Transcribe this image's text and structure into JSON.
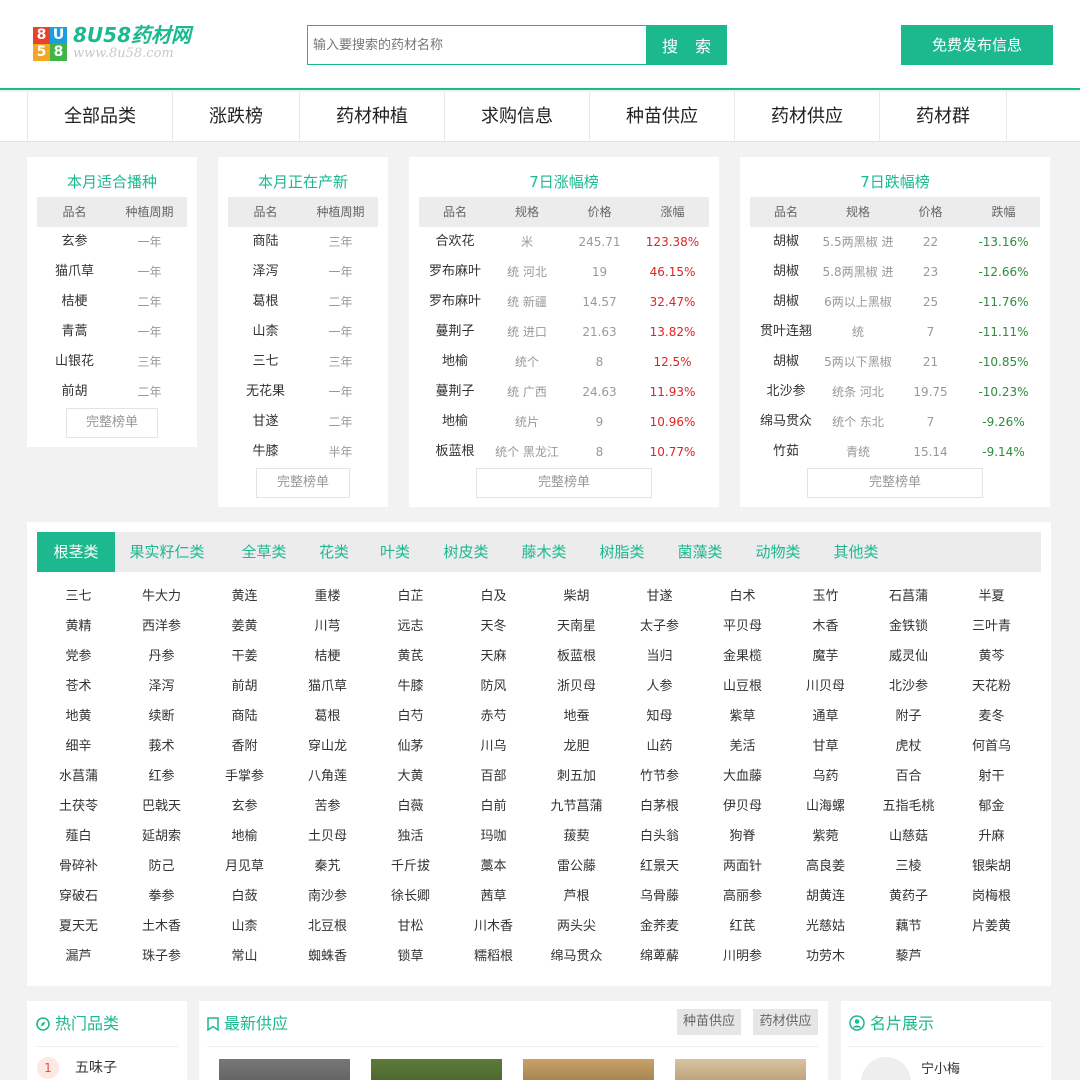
{
  "header": {
    "logo_badge": [
      "8",
      "U",
      "5",
      "8"
    ],
    "logo_text": "8U58药材网",
    "logo_url": "www.8u58.com",
    "search_placeholder": "输入要搜索的药材名称",
    "search_button": "搜 索",
    "publish_button": "免费发布信息"
  },
  "colors": {
    "brand": "#1cb98f",
    "up": "#e02424",
    "down": "#2c8d3a"
  },
  "nav": [
    "全部品类",
    "涨跌榜",
    "药材种植",
    "求购信息",
    "种苗供应",
    "药材供应",
    "药材群"
  ],
  "sow": {
    "title": "本月适合播种",
    "headers": [
      "品名",
      "种植周期"
    ],
    "rows": [
      [
        "玄参",
        "一年"
      ],
      [
        "猫爪草",
        "一年"
      ],
      [
        "桔梗",
        "二年"
      ],
      [
        "青蒿",
        "一年"
      ],
      [
        "山银花",
        "三年"
      ],
      [
        "前胡",
        "二年"
      ]
    ],
    "more": "完整榜单"
  },
  "harvest": {
    "title": "本月正在产新",
    "headers": [
      "品名",
      "种植周期"
    ],
    "rows": [
      [
        "商陆",
        "三年"
      ],
      [
        "泽泻",
        "一年"
      ],
      [
        "葛根",
        "二年"
      ],
      [
        "山柰",
        "一年"
      ],
      [
        "三七",
        "三年"
      ],
      [
        "无花果",
        "一年"
      ],
      [
        "甘遂",
        "二年"
      ],
      [
        "牛膝",
        "半年"
      ]
    ],
    "more": "完整榜单"
  },
  "rise": {
    "title": "7日涨幅榜",
    "headers": [
      "品名",
      "规格",
      "价格",
      "涨幅"
    ],
    "rows": [
      [
        "合欢花",
        "米",
        "245.71",
        "123.38%"
      ],
      [
        "罗布麻叶",
        "统 河北",
        "19",
        "46.15%"
      ],
      [
        "罗布麻叶",
        "统 新疆",
        "14.57",
        "32.47%"
      ],
      [
        "蔓荆子",
        "统 进口",
        "21.63",
        "13.82%"
      ],
      [
        "地榆",
        "统个",
        "8",
        "12.5%"
      ],
      [
        "蔓荆子",
        "统 广西",
        "24.63",
        "11.93%"
      ],
      [
        "地榆",
        "统片",
        "9",
        "10.96%"
      ],
      [
        "板蓝根",
        "统个 黑龙江",
        "8",
        "10.77%"
      ]
    ],
    "more": "完整榜单"
  },
  "fall": {
    "title": "7日跌幅榜",
    "headers": [
      "品名",
      "规格",
      "价格",
      "跌幅"
    ],
    "rows": [
      [
        "胡椒",
        "5.5两黑椒 进",
        "22",
        "-13.16%"
      ],
      [
        "胡椒",
        "5.8两黑椒 进",
        "23",
        "-12.66%"
      ],
      [
        "胡椒",
        "6两以上黑椒",
        "25",
        "-11.76%"
      ],
      [
        "贯叶连翘",
        "统",
        "7",
        "-11.11%"
      ],
      [
        "胡椒",
        "5两以下黑椒",
        "21",
        "-10.85%"
      ],
      [
        "北沙参",
        "统条 河北",
        "19.75",
        "-10.23%"
      ],
      [
        "绵马贯众",
        "统个 东北",
        "7",
        "-9.26%"
      ],
      [
        "竹茹",
        "青统",
        "15.14",
        "-9.14%"
      ]
    ],
    "more": "完整榜单"
  },
  "categories": {
    "tabs": [
      "根茎类",
      "果实籽仁类",
      "全草类",
      "花类",
      "叶类",
      "树皮类",
      "藤木类",
      "树脂类",
      "菌藻类",
      "动物类",
      "其他类"
    ],
    "active_tab": 0,
    "herbs": [
      "三七",
      "牛大力",
      "黄连",
      "重楼",
      "白芷",
      "白及",
      "柴胡",
      "甘遂",
      "白术",
      "玉竹",
      "石菖蒲",
      "半夏",
      "黄精",
      "西洋参",
      "姜黄",
      "川芎",
      "远志",
      "天冬",
      "天南星",
      "太子参",
      "平贝母",
      "木香",
      "金铁锁",
      "三叶青",
      "党参",
      "丹参",
      "干姜",
      "桔梗",
      "黄芪",
      "天麻",
      "板蓝根",
      "当归",
      "金果榄",
      "魔芋",
      "威灵仙",
      "黄芩",
      "苍术",
      "泽泻",
      "前胡",
      "猫爪草",
      "牛膝",
      "防风",
      "浙贝母",
      "人参",
      "山豆根",
      "川贝母",
      "北沙参",
      "天花粉",
      "地黄",
      "续断",
      "商陆",
      "葛根",
      "白芍",
      "赤芍",
      "地蚕",
      "知母",
      "紫草",
      "通草",
      "附子",
      "麦冬",
      "细辛",
      "莪术",
      "香附",
      "穿山龙",
      "仙茅",
      "川乌",
      "龙胆",
      "山药",
      "羌活",
      "甘草",
      "虎杖",
      "何首乌",
      "水菖蒲",
      "红参",
      "手掌参",
      "八角莲",
      "大黄",
      "百部",
      "刺五加",
      "竹节参",
      "大血藤",
      "乌药",
      "百合",
      "射干",
      "土茯苓",
      "巴戟天",
      "玄参",
      "苦参",
      "白薇",
      "白前",
      "九节菖蒲",
      "白茅根",
      "伊贝母",
      "山海螺",
      "五指毛桃",
      "郁金",
      "薤白",
      "延胡索",
      "地榆",
      "土贝母",
      "独活",
      "玛咖",
      "菝葜",
      "白头翁",
      "狗脊",
      "紫菀",
      "山慈菇",
      "升麻",
      "骨碎补",
      "防己",
      "月见草",
      "秦艽",
      "千斤拔",
      "藁本",
      "雷公藤",
      "红景天",
      "两面针",
      "高良姜",
      "三棱",
      "银柴胡",
      "穿破石",
      "拳参",
      "白蔹",
      "南沙参",
      "徐长卿",
      "茜草",
      "芦根",
      "乌骨藤",
      "高丽参",
      "胡黄连",
      "黄药子",
      "岗梅根",
      "夏天无",
      "土木香",
      "山柰",
      "北豆根",
      "甘松",
      "川木香",
      "两头尖",
      "金荞麦",
      "红芪",
      "光慈姑",
      "藕节",
      "片姜黄",
      "漏芦",
      "珠子参",
      "常山",
      "蜘蛛香",
      "锁草",
      "糯稻根",
      "绵马贯众",
      "绵萆薢",
      "川明参",
      "功劳木",
      "藜芦"
    ]
  },
  "hot": {
    "title": "热门品类",
    "items": [
      {
        "rank": "1",
        "name": "五味子"
      }
    ]
  },
  "supply": {
    "title": "最新供应",
    "tags": [
      "种苗供应",
      "药材供应"
    ]
  },
  "cards": {
    "title": "名片展示",
    "name": "宁小梅"
  }
}
